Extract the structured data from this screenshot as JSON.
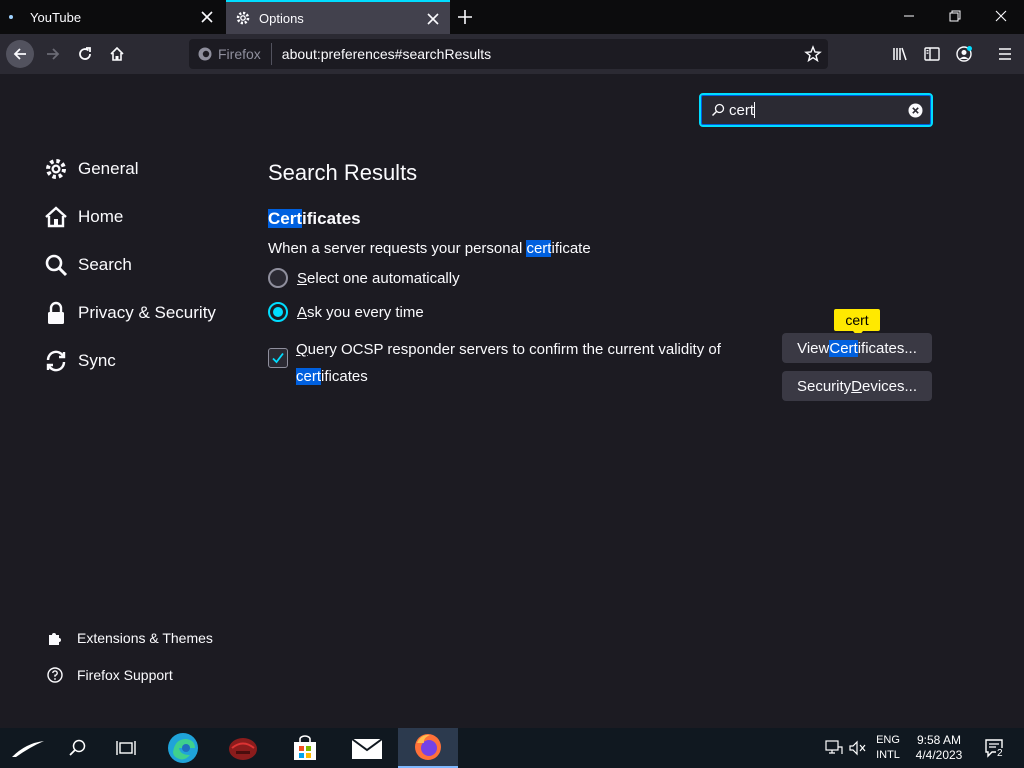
{
  "tabs": [
    {
      "title": "YouTube",
      "active": false
    },
    {
      "title": "Options",
      "active": true
    }
  ],
  "urlbar": {
    "identity_label": "Firefox",
    "url": "about:preferences#searchResults"
  },
  "find": {
    "value": "cert",
    "placeholder": "Find in Options"
  },
  "sidebar": {
    "categories": [
      {
        "label": "General",
        "icon": "gear-icon"
      },
      {
        "label": "Home",
        "icon": "home-icon"
      },
      {
        "label": "Search",
        "icon": "search-icon"
      },
      {
        "label": "Privacy & Security",
        "icon": "lock-icon"
      },
      {
        "label": "Sync",
        "icon": "sync-icon"
      }
    ],
    "footer": [
      {
        "label": "Extensions & Themes",
        "icon": "puzzle-icon"
      },
      {
        "label": "Firefox Support",
        "icon": "help-icon"
      }
    ]
  },
  "results": {
    "title": "Search Results",
    "section_title_hl": "Cert",
    "section_title_rest": "ificates",
    "desc_before": "When a server requests your personal ",
    "desc_hl": "cert",
    "desc_after": "ificate",
    "radio_auto_key": "S",
    "radio_auto_rest": "elect one automatically",
    "radio_ask_key": "A",
    "radio_ask_rest": "sk you every time",
    "radio_selected": "ask",
    "ocsp_key": "Q",
    "ocsp_line1_rest": "uery OCSP responder servers to confirm the current validity of",
    "ocsp_line2_hl": "cert",
    "ocsp_line2_rest": "ificates",
    "ocsp_checked": true,
    "view_btn_before": "View ",
    "view_btn_hl": "Cert",
    "view_btn_after": "ificates...",
    "devices_btn_before": "Security ",
    "devices_btn_key": "D",
    "devices_btn_after": "evices...",
    "tooltip": "cert"
  },
  "taskbar": {
    "lang_top": "ENG",
    "lang_bottom": "INTL",
    "time": "9:58 AM",
    "date": "4/4/2023",
    "notification_count": "2"
  },
  "colors": {
    "accent": "#00ddff",
    "highlight": "#0060df",
    "tooltip": "#ffe900"
  }
}
